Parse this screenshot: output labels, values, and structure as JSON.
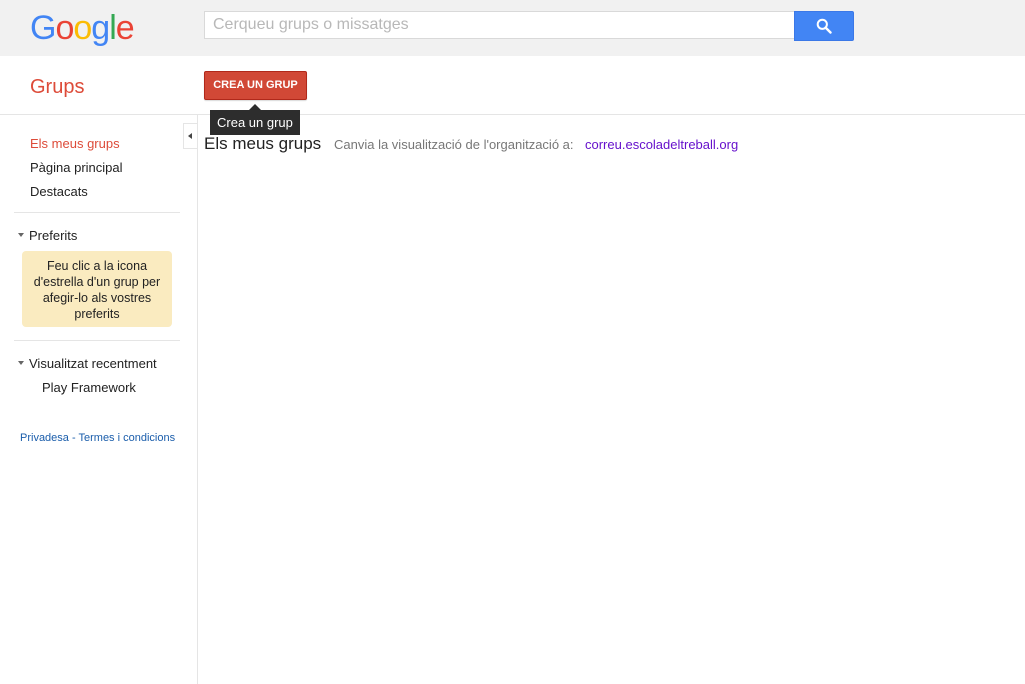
{
  "header": {
    "logo_letters": [
      {
        "char": "G",
        "color": "#4285f4"
      },
      {
        "char": "o",
        "color": "#ea4335"
      },
      {
        "char": "o",
        "color": "#fbbc05"
      },
      {
        "char": "g",
        "color": "#4285f4"
      },
      {
        "char": "l",
        "color": "#34a853"
      },
      {
        "char": "e",
        "color": "#ea4335"
      }
    ],
    "search_placeholder": "Cerqueu grups o missatges",
    "search_button_icon": "search-icon"
  },
  "subheader": {
    "app_title": "Grups",
    "create_button": "CREA UN GRUP",
    "create_tooltip": "Crea un grup"
  },
  "sidebar": {
    "nav": [
      {
        "label": "Els meus grups",
        "active": true
      },
      {
        "label": "Pàgina principal",
        "active": false
      },
      {
        "label": "Destacats",
        "active": false
      }
    ],
    "favorites": {
      "heading": "Preferits",
      "hint": "Feu clic a la icona d'estrella d'un grup per afegir-lo als vostres preferits"
    },
    "recent": {
      "heading": "Visualitzat recentment",
      "items": [
        "Play Framework"
      ]
    },
    "footer": {
      "privacy": "Privadesa",
      "separator": " - ",
      "terms": "Termes i condicions"
    }
  },
  "main": {
    "title": "Els meus grups",
    "org_label": "Canvia la visualització de l'organització a:",
    "org_link": "correu.escoladeltreball.org"
  },
  "colors": {
    "accent_red": "#dd4b39",
    "button_red": "#d14836",
    "search_blue": "#4285f4",
    "hint_bg": "#faebc0",
    "link_blue": "#1a5dab",
    "visited_purple": "#6611cc"
  }
}
